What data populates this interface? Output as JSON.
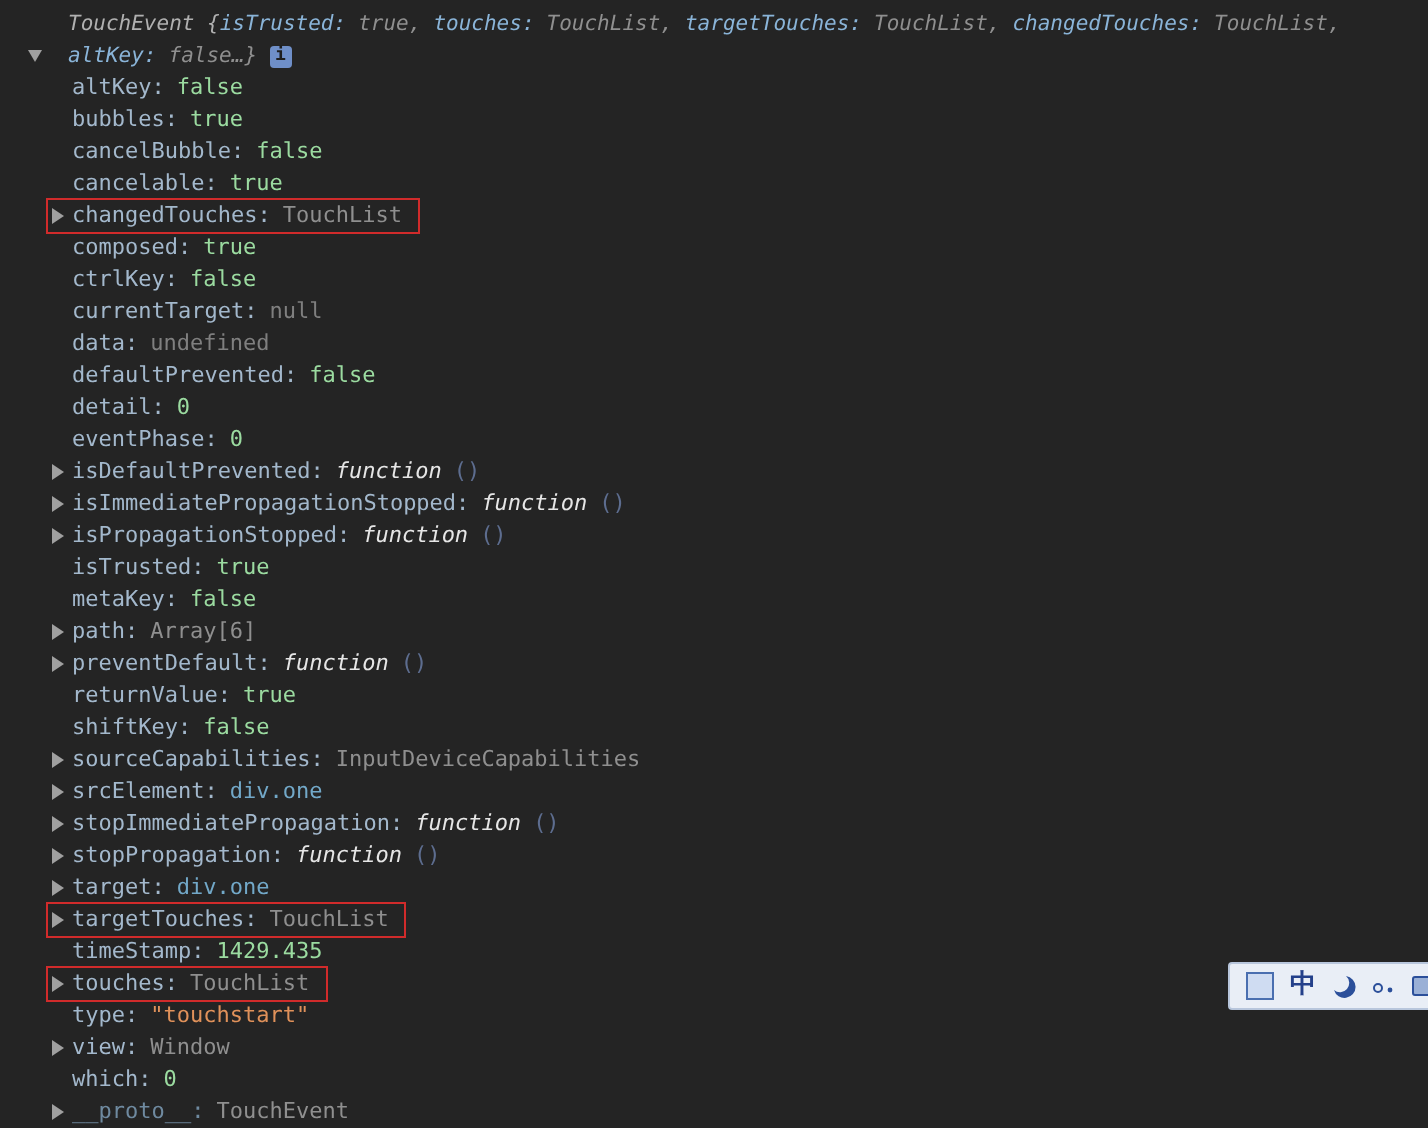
{
  "header": {
    "expanded": true,
    "class_name": "TouchEvent {",
    "preview": [
      {
        "key": "isTrusted:",
        "value": "true,"
      },
      {
        "key": "touches:",
        "value": "TouchList,"
      },
      {
        "key": "targetTouches:",
        "value": "TouchList,"
      },
      {
        "key": "changedTouches:",
        "value": "TouchList,"
      },
      {
        "key": "altKey:",
        "value": "false…}"
      }
    ],
    "info_badge": "i"
  },
  "properties": [
    {
      "key": "altKey:",
      "value": "false",
      "kind": "bool",
      "expandable": false,
      "highlighted": false
    },
    {
      "key": "bubbles:",
      "value": "true",
      "kind": "bool",
      "expandable": false,
      "highlighted": false
    },
    {
      "key": "cancelBubble:",
      "value": "false",
      "kind": "bool",
      "expandable": false,
      "highlighted": false
    },
    {
      "key": "cancelable:",
      "value": "true",
      "kind": "bool",
      "expandable": false,
      "highlighted": false
    },
    {
      "key": "changedTouches:",
      "value": "TouchList",
      "kind": "object",
      "expandable": true,
      "highlighted": true
    },
    {
      "key": "composed:",
      "value": "true",
      "kind": "bool",
      "expandable": false,
      "highlighted": false
    },
    {
      "key": "ctrlKey:",
      "value": "false",
      "kind": "bool",
      "expandable": false,
      "highlighted": false
    },
    {
      "key": "currentTarget:",
      "value": "null",
      "kind": "null",
      "expandable": false,
      "highlighted": false
    },
    {
      "key": "data:",
      "value": "undefined",
      "kind": "null",
      "expandable": false,
      "highlighted": false
    },
    {
      "key": "defaultPrevented:",
      "value": "false",
      "kind": "bool",
      "expandable": false,
      "highlighted": false
    },
    {
      "key": "detail:",
      "value": "0",
      "kind": "number",
      "expandable": false,
      "highlighted": false
    },
    {
      "key": "eventPhase:",
      "value": "0",
      "kind": "number",
      "expandable": false,
      "highlighted": false
    },
    {
      "key": "isDefaultPrevented:",
      "value": "function",
      "args": "()",
      "kind": "function",
      "expandable": true,
      "highlighted": false
    },
    {
      "key": "isImmediatePropagationStopped:",
      "value": "function",
      "args": "()",
      "kind": "function",
      "expandable": true,
      "highlighted": false
    },
    {
      "key": "isPropagationStopped:",
      "value": "function",
      "args": "()",
      "kind": "function",
      "expandable": true,
      "highlighted": false
    },
    {
      "key": "isTrusted:",
      "value": "true",
      "kind": "bool",
      "expandable": false,
      "highlighted": false
    },
    {
      "key": "metaKey:",
      "value": "false",
      "kind": "bool",
      "expandable": false,
      "highlighted": false
    },
    {
      "key": "path:",
      "value": "Array[6]",
      "kind": "object",
      "expandable": true,
      "highlighted": false
    },
    {
      "key": "preventDefault:",
      "value": "function",
      "args": "()",
      "kind": "function",
      "expandable": true,
      "highlighted": false
    },
    {
      "key": "returnValue:",
      "value": "true",
      "kind": "bool",
      "expandable": false,
      "highlighted": false
    },
    {
      "key": "shiftKey:",
      "value": "false",
      "kind": "bool",
      "expandable": false,
      "highlighted": false
    },
    {
      "key": "sourceCapabilities:",
      "value": "InputDeviceCapabilities",
      "kind": "object",
      "expandable": true,
      "highlighted": false
    },
    {
      "key": "srcElement:",
      "value": "div.one",
      "kind": "node",
      "expandable": true,
      "highlighted": false
    },
    {
      "key": "stopImmediatePropagation:",
      "value": "function",
      "args": "()",
      "kind": "function",
      "expandable": true,
      "highlighted": false
    },
    {
      "key": "stopPropagation:",
      "value": "function",
      "args": "()",
      "kind": "function",
      "expandable": true,
      "highlighted": false
    },
    {
      "key": "target:",
      "value": "div.one",
      "kind": "node",
      "expandable": true,
      "highlighted": false
    },
    {
      "key": "targetTouches:",
      "value": "TouchList",
      "kind": "object",
      "expandable": true,
      "highlighted": true
    },
    {
      "key": "timeStamp:",
      "value": "1429.435",
      "kind": "number",
      "expandable": false,
      "highlighted": false
    },
    {
      "key": "touches:",
      "value": "TouchList",
      "kind": "object",
      "expandable": true,
      "highlighted": true
    },
    {
      "key": "type:",
      "value": "\"touchstart\"",
      "kind": "string",
      "expandable": false,
      "highlighted": false
    },
    {
      "key": "view:",
      "value": "Window",
      "kind": "object",
      "expandable": true,
      "highlighted": false
    },
    {
      "key": "which:",
      "value": "0",
      "kind": "number",
      "expandable": false,
      "highlighted": false
    },
    {
      "key": "__proto__:",
      "value": "TouchEvent",
      "kind": "object",
      "expandable": true,
      "highlighted": false,
      "dimmed": true
    }
  ],
  "ime_toolbar": {
    "mode_label": "中"
  }
}
